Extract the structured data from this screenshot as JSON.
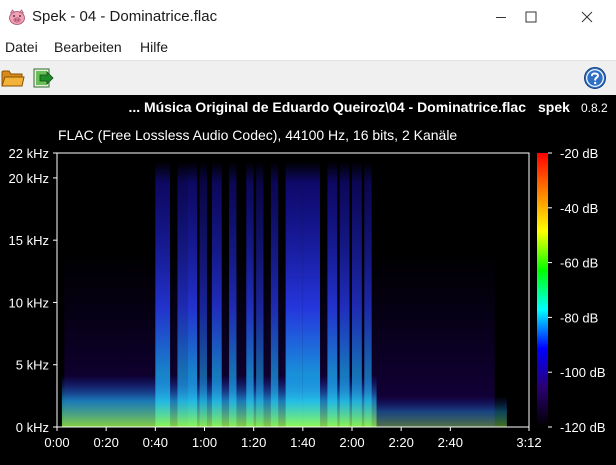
{
  "window": {
    "title": "Spek - 04 - Dominatrice.flac",
    "app_icon": "pig-icon",
    "controls": [
      "minimize-icon",
      "maximize-icon",
      "close-icon"
    ]
  },
  "menu": {
    "items": [
      "Datei",
      "Bearbeiten",
      "Hilfe"
    ]
  },
  "toolbar": {
    "buttons": [
      "open-folder-icon",
      "save-export-icon"
    ],
    "help": "help-icon"
  },
  "spectrogram": {
    "file_title": "... Música Original de Eduardo Queiroz\\04 - Dominatrice.flac",
    "app_name": "spek",
    "version": "0.8.2",
    "file_info": "FLAC (Free Lossless Audio Codec), 44100 Hz, 16 bits, 2 Kanäle"
  },
  "chart_data": {
    "type": "heatmap",
    "title": "... Música Original de Eduardo Queiroz\\04 - Dominatrice.flac",
    "subtitle": "FLAC (Free Lossless Audio Codec), 44100 Hz, 16 bits, 2 Kanäle",
    "x_unit": "seconds",
    "x_range": [
      0,
      192
    ],
    "x_ticks": [
      {
        "value": 0,
        "label": "0:00"
      },
      {
        "value": 20,
        "label": "0:20"
      },
      {
        "value": 40,
        "label": "0:40"
      },
      {
        "value": 60,
        "label": "1:00"
      },
      {
        "value": 80,
        "label": "1:20"
      },
      {
        "value": 100,
        "label": "1:40"
      },
      {
        "value": 120,
        "label": "2:00"
      },
      {
        "value": 140,
        "label": "2:20"
      },
      {
        "value": 160,
        "label": "2:40"
      },
      {
        "value": 192,
        "label": "3:12"
      }
    ],
    "y_unit": "kHz",
    "y_range": [
      0,
      22
    ],
    "y_ticks": [
      {
        "value": 0,
        "label": "0 kHz"
      },
      {
        "value": 5,
        "label": "5 kHz"
      },
      {
        "value": 10,
        "label": "10 kHz"
      },
      {
        "value": 15,
        "label": "15 kHz"
      },
      {
        "value": 20,
        "label": "20 kHz"
      },
      {
        "value": 22,
        "label": "22 kHz"
      }
    ],
    "color_scale": {
      "unit": "dB",
      "range": [
        -120,
        -20
      ],
      "ticks": [
        {
          "value": -20,
          "label": "-20 dB"
        },
        {
          "value": -40,
          "label": "-40 dB"
        },
        {
          "value": -60,
          "label": "-60 dB"
        },
        {
          "value": -80,
          "label": "-80 dB"
        },
        {
          "value": -100,
          "label": "-100 dB"
        },
        {
          "value": -120,
          "label": "-120 dB"
        }
      ],
      "colors": [
        "#ff0000",
        "#ff8000",
        "#ffff00",
        "#00ff00",
        "#00ffff",
        "#0000ff",
        "#2a0070",
        "#000000"
      ]
    },
    "bright_bands_seconds": [
      {
        "start": 40,
        "end": 46,
        "level_db": -75
      },
      {
        "start": 49,
        "end": 53,
        "level_db": -80
      },
      {
        "start": 53,
        "end": 57,
        "level_db": -75
      },
      {
        "start": 58,
        "end": 61,
        "level_db": -85
      },
      {
        "start": 63,
        "end": 67,
        "level_db": -78
      },
      {
        "start": 70,
        "end": 73,
        "level_db": -80
      },
      {
        "start": 77,
        "end": 80,
        "level_db": -78
      },
      {
        "start": 81,
        "end": 84,
        "level_db": -85
      },
      {
        "start": 87,
        "end": 90,
        "level_db": -80
      },
      {
        "start": 93,
        "end": 100,
        "level_db": -72
      },
      {
        "start": 100,
        "end": 107,
        "level_db": -72
      },
      {
        "start": 110,
        "end": 114,
        "level_db": -75
      },
      {
        "start": 115,
        "end": 119,
        "level_db": -78
      },
      {
        "start": 120,
        "end": 124,
        "level_db": -80
      },
      {
        "start": 125,
        "end": 128,
        "level_db": -82
      }
    ],
    "high_cutoff_khz": 22
  }
}
